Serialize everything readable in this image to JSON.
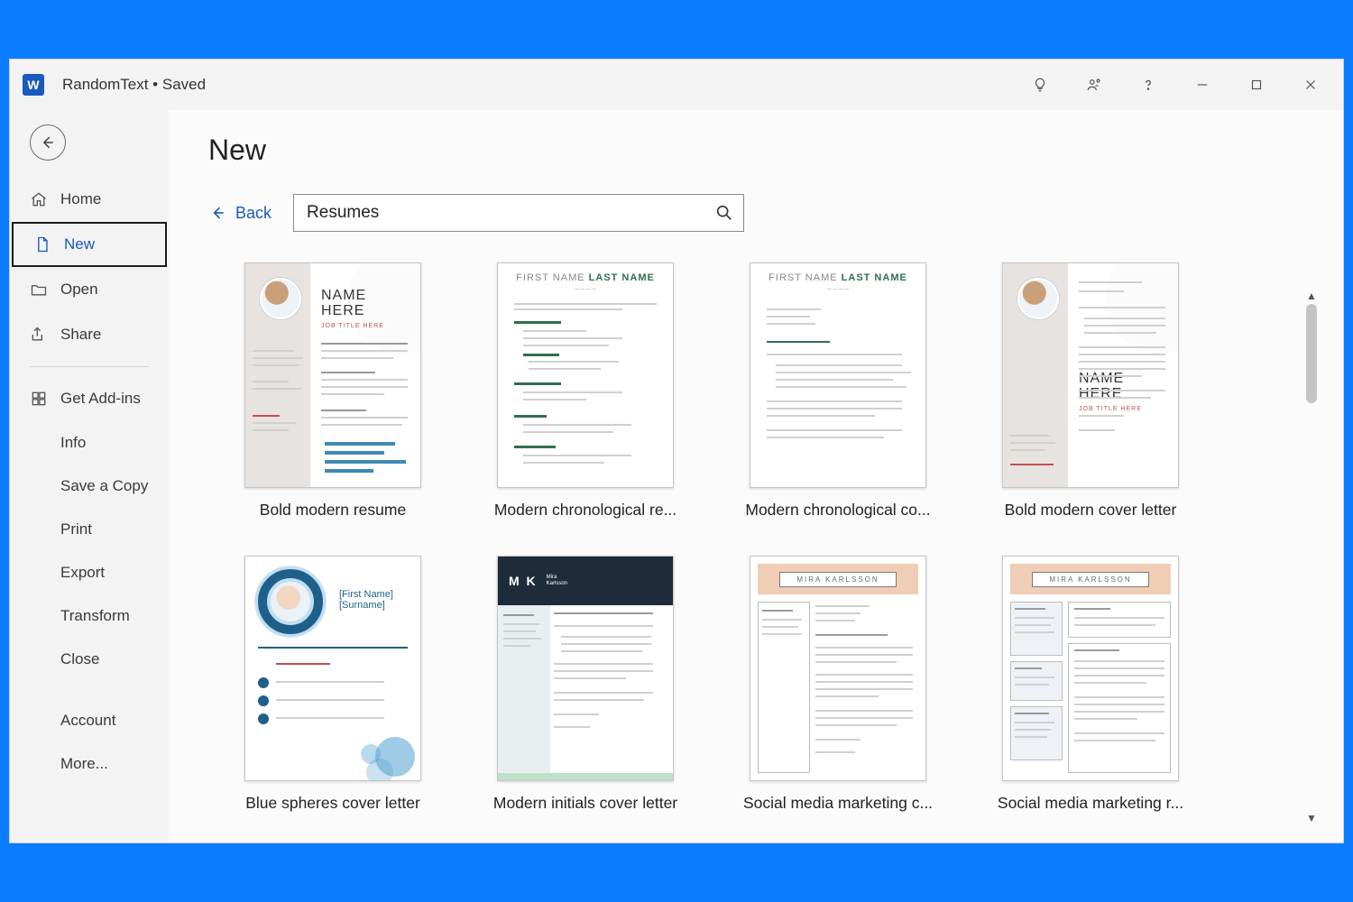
{
  "titlebar": {
    "doc_name": "RandomText",
    "save_state": "Saved"
  },
  "sidebar": {
    "items": [
      {
        "key": "home",
        "label": "Home"
      },
      {
        "key": "new",
        "label": "New"
      },
      {
        "key": "open",
        "label": "Open"
      },
      {
        "key": "share",
        "label": "Share"
      }
    ],
    "addins_label": "Get Add-ins",
    "sub": [
      {
        "key": "info",
        "label": "Info"
      },
      {
        "key": "saveacopy",
        "label": "Save a Copy"
      },
      {
        "key": "print",
        "label": "Print"
      },
      {
        "key": "export",
        "label": "Export"
      },
      {
        "key": "transform",
        "label": "Transform"
      },
      {
        "key": "close",
        "label": "Close"
      }
    ],
    "footer": [
      {
        "key": "account",
        "label": "Account"
      },
      {
        "key": "more",
        "label": "More..."
      }
    ]
  },
  "main": {
    "heading": "New",
    "back_label": "Back",
    "search_value": "Resumes"
  },
  "templates": [
    {
      "key": "bold-modern-resume",
      "label": "Bold modern resume"
    },
    {
      "key": "modern-chronological-resume",
      "label": "Modern chronological re..."
    },
    {
      "key": "modern-chronological-cover",
      "label": "Modern chronological co..."
    },
    {
      "key": "bold-modern-cover-letter",
      "label": "Bold modern cover letter"
    },
    {
      "key": "blue-spheres-cover-letter",
      "label": "Blue spheres cover letter"
    },
    {
      "key": "modern-initials-cover-letter",
      "label": "Modern initials cover letter"
    },
    {
      "key": "social-media-marketing-cover",
      "label": "Social media marketing c..."
    },
    {
      "key": "social-media-marketing-resume",
      "label": "Social media marketing r..."
    }
  ],
  "thumb_text": {
    "name_here": "NAME\nHERE",
    "job_title": "JOB TITLE HERE",
    "first_last": {
      "first": "FIRST NAME",
      "last": "LAST NAME"
    },
    "mk": "M K",
    "mk_name": "Mira\nKarlsson",
    "mira": "MIRA KARLSSON",
    "bs_name": "[First Name]\n[Surname]"
  }
}
